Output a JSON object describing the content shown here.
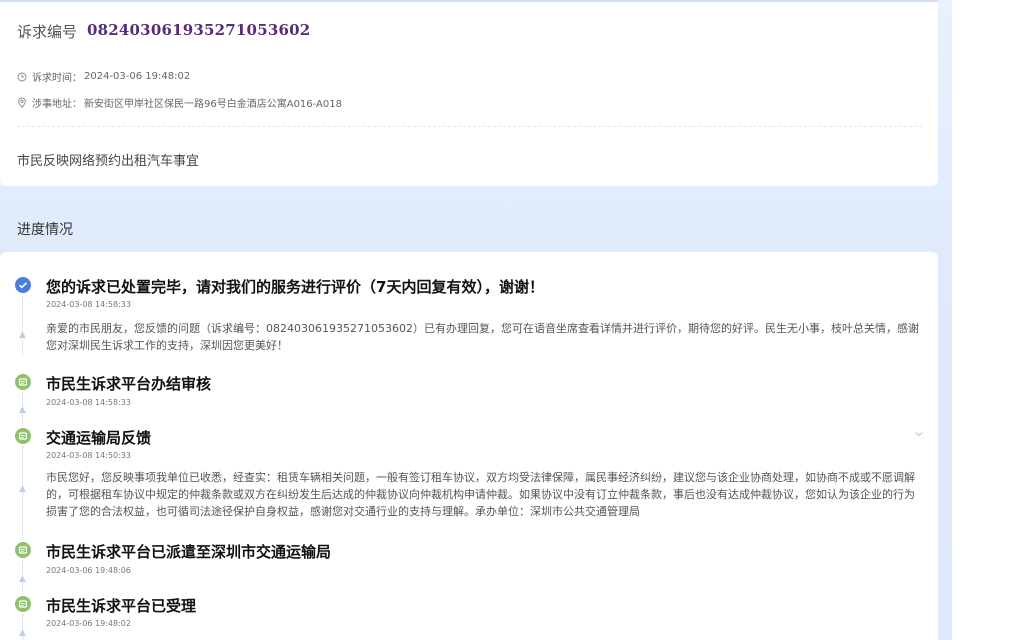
{
  "case": {
    "label": "诉求编号",
    "number": "08240306193527105360​2"
  },
  "meta": {
    "time_key": "诉求时间：",
    "time_value": "2024-03-06 19:48:02",
    "addr_key": "涉事地址：",
    "addr_value": "新安街区甲岸社区保民一路96号白金酒店公寓A016-A018"
  },
  "summary": "市民反映网络预约出租汽车事宜",
  "progress": {
    "section_title": "进度情况",
    "items": [
      {
        "title": "您的诉求已处置完毕，请对我们的服务进行评价（7天内回复有效），谢谢！",
        "time": "2024-03-08 14:58:33",
        "desc": "亲爱的市民朋友，您反馈的问题（诉求编号：08240306193527105360​2）已有办理回复，您可在语音坐席查看详情并进行评价，期待您的好评。民生无小事，枝叶总关情，感谢您对深圳民生诉求工作的支持，深圳因您更美好！"
      },
      {
        "title": "市民生诉求平台办结审核",
        "time": "2024-03-08 14:58:33",
        "desc": ""
      },
      {
        "title": "交通运输局反馈",
        "time": "2024-03-08 14:50:33",
        "desc": "市民您好，您反映事项我单位已收悉，经查实：租赁车辆相关问题，一般有签订租车协议，双方均受法律保障，属民事经济纠纷，建议您与该企业协商处理，如协商不成或不愿调解的，可根据租车协议中规定的仲裁条款或双方在纠纷发生后达成的仲裁协议向仲裁机构申请仲裁。如果协议中没有订立仲裁条款，事后也没有达成仲裁协议，您如认为该企业的行为损害了您的合法权益，也可循司法途径保护自身权益，感谢您对交通行业的支持与理解。承办单位：深圳市公共交通管理局"
      },
      {
        "title": "市民生诉求平台已派遣至深圳市交通运输局",
        "time": "2024-03-06 19:48:06",
        "desc": ""
      },
      {
        "title": "市民生诉求平台已受理",
        "time": "2024-03-06 19:48:02",
        "desc": ""
      }
    ]
  },
  "colors": {
    "accent_blue": "#4a7de0",
    "step_green": "#8fc26d",
    "case_number": "#5a2a7a"
  },
  "icons": [
    "clock-icon",
    "location-pin-icon",
    "check-circle-icon",
    "step-icon",
    "chevron-down-icon"
  ]
}
